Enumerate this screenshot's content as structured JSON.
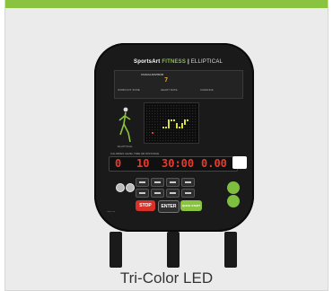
{
  "caption": "Tri-Color LED",
  "console": {
    "brand_main": "SportsArt",
    "brand_sub": "FITNESS",
    "model": "ELLIPTICAL",
    "coach_advisor": "COACH ADVISOR",
    "coach_digit": "7",
    "row_labels": [
      "WORKOUT ZONE",
      "HEART RATE",
      "CADENCE"
    ],
    "runner_label": "ELLIPTICAL",
    "lcd_labels": "CALORIES   LEVEL   TIME   HR   DISTANCE",
    "lcd": {
      "calories": "0",
      "level": "10",
      "time": "30:00",
      "distance": "0.00"
    },
    "enter_label": "ENTER",
    "stop_label": "STOP",
    "quick_start_label": "QUICK START",
    "warning": "CAUTION"
  },
  "colors": {
    "accent_green": "#8ac33f",
    "led_red": "#e83a2a",
    "led_amber": "#d8a43a",
    "stop_red": "#d8312a",
    "quick_start_green": "#8ac33f"
  }
}
